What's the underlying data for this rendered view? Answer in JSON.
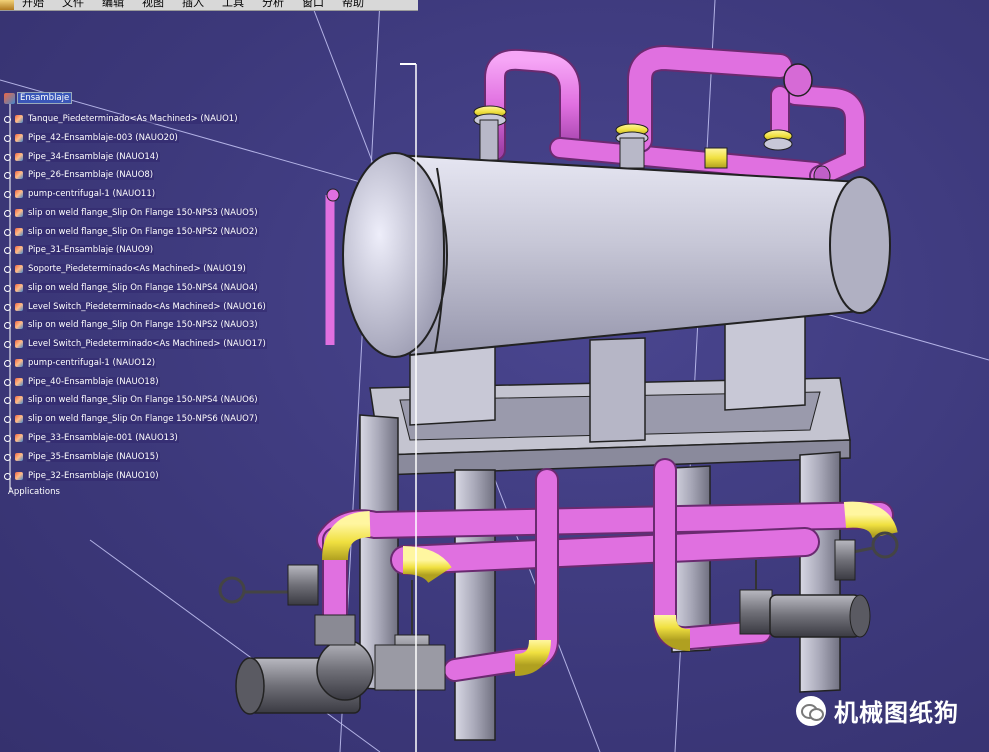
{
  "menu": {
    "items": [
      "开始",
      "文件",
      "编辑",
      "视图",
      "插入",
      "工具",
      "分析",
      "窗口",
      "帮助"
    ]
  },
  "tree": {
    "root": "Ensamblaje",
    "nodes": [
      "Tanque_Piedeterminado<As Machined> (NAUO1)",
      "Pipe_42-Ensamblaje-003 (NAUO20)",
      "Pipe_34-Ensamblaje (NAUO14)",
      "Pipe_26-Ensamblaje (NAUO8)",
      "pump-centrifugal-1 (NAUO11)",
      "slip on weld flange_Slip On Flange 150-NPS3 (NAUO5)",
      "slip on weld flange_Slip On Flange 150-NPS2 (NAUO2)",
      "Pipe_31-Ensamblaje (NAUO9)",
      "Soporte_Piedeterminado<As Machined> (NAUO19)",
      "slip on weld flange_Slip On Flange 150-NPS4 (NAUO4)",
      "Level Switch_Piedeterminado<As Machined> (NAUO16)",
      "slip on weld flange_Slip On Flange 150-NPS2 (NAUO3)",
      "Level Switch_Piedeterminado<As Machined> (NAUO17)",
      "pump-centrifugal-1 (NAUO12)",
      "Pipe_40-Ensamblaje (NAUO18)",
      "slip on weld flange_Slip On Flange 150-NPS4 (NAUO6)",
      "slip on weld flange_Slip On Flange 150-NPS6 (NAUO7)",
      "Pipe_33-Ensamblaje-001 (NAUO13)",
      "Pipe_35-Ensamblaje (NAUO15)",
      "Pipe_32-Ensamblaje (NAUO10)"
    ],
    "applications": "Applications"
  },
  "watermark": {
    "text": "机械图纸狗"
  },
  "colors": {
    "background": "#3f3b7c",
    "pipe_magenta": "#e070e0",
    "flange_yellow": "#f0e040",
    "tank_gray": "#c8c8d8"
  }
}
